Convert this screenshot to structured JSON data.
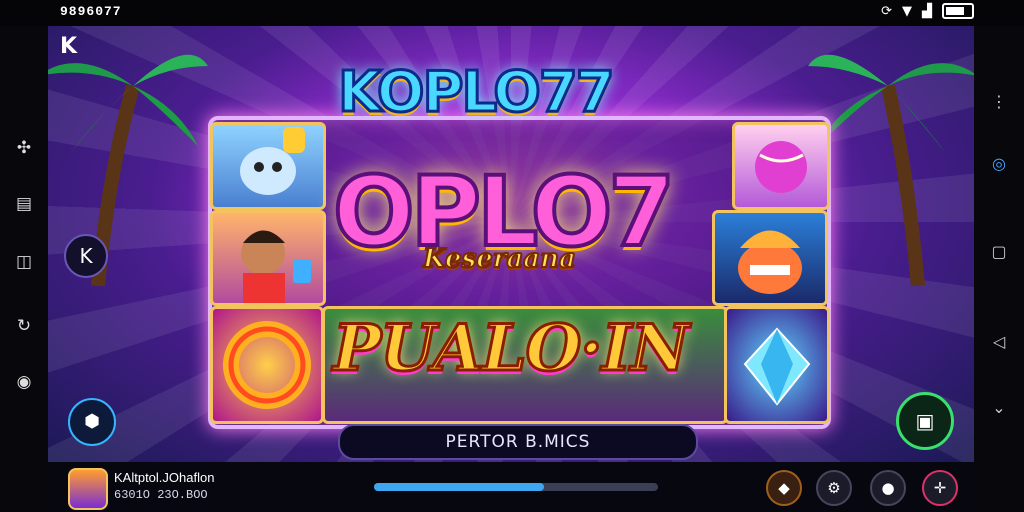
{
  "status_bar": {
    "time": "9896077",
    "icons": [
      "sync-icon",
      "wifi-icon",
      "signal-icon",
      "battery-icon"
    ]
  },
  "sidebar_icons": [
    "puzzle-icon",
    "book-icon",
    "chat-icon",
    "refresh-icon",
    "settings-icon"
  ],
  "nav_buttons": [
    "menu-icon",
    "record-icon",
    "home-icon",
    "back-triangle-icon",
    "chevron-down-icon"
  ],
  "game": {
    "back_label": "K",
    "title_top": "KOPLO77",
    "title_main": "OPLO7",
    "subtitle": "Keseraana",
    "title_bottom": "PUALO·IN",
    "side_button_label": "K",
    "bonus_bar": "PERTOR B.MICS",
    "colors": {
      "accent": "#ff5fd9",
      "gold": "#ffc93a",
      "cyan": "#49d8ff",
      "frame": "#e3b7ff"
    }
  },
  "bottom_bar": {
    "player_name": "KAltptol.JOhaflon",
    "player_number": "6301O 23O.BOO",
    "progress": 0.6,
    "actions": [
      "fruit-icon",
      "share-icon",
      "location-icon",
      "compass-icon"
    ]
  }
}
